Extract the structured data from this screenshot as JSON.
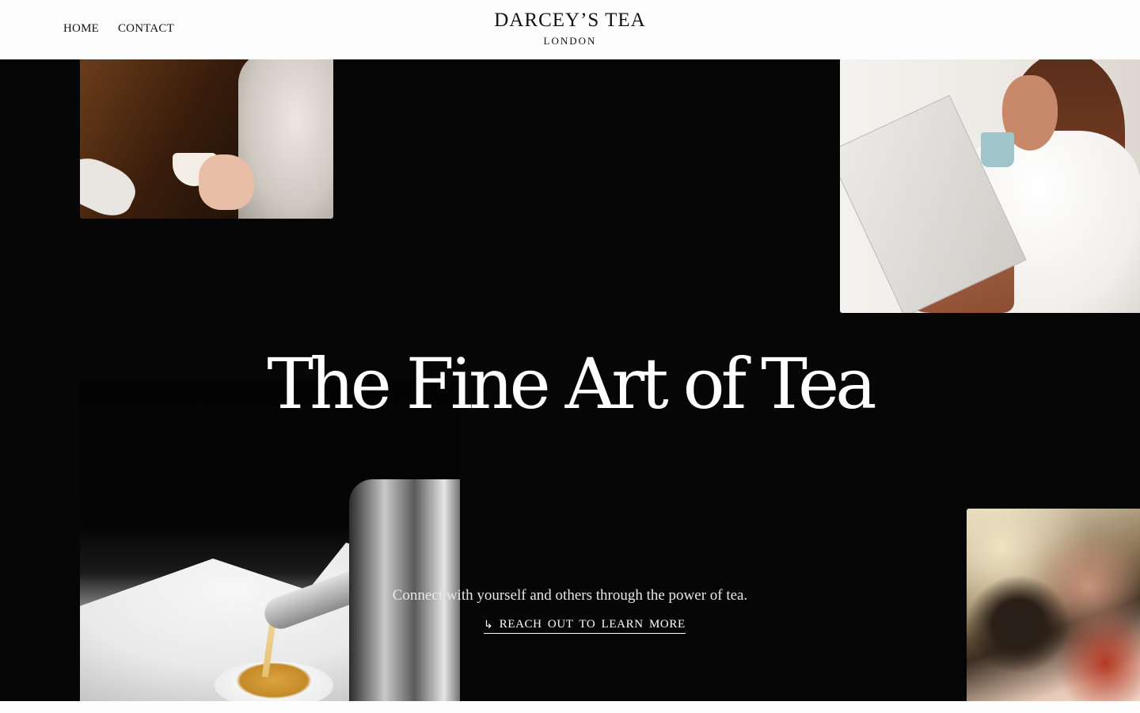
{
  "nav": {
    "items": [
      {
        "label": "HOME"
      },
      {
        "label": "CONTACT"
      }
    ]
  },
  "brand": {
    "name": "DARCEY’S TEA",
    "location": "LONDON"
  },
  "hero": {
    "title": "The Fine Art of Tea",
    "subtitle": "Connect with yourself and others through the power of tea.",
    "cta": {
      "icon": "return-arrow-icon",
      "label": "REACH OUT TO LEARN MORE"
    },
    "photos": [
      {
        "name": "woman-holding-tea-cup-photo"
      },
      {
        "name": "woman-reading-newspaper-photo"
      },
      {
        "name": "teapot-pouring-tea-photo"
      },
      {
        "name": "marbled-abstract-art-photo"
      }
    ]
  },
  "colors": {
    "background": "#060606",
    "header": "#fdfdfd",
    "text_light": "#ffffff",
    "text_dark": "#111111"
  }
}
